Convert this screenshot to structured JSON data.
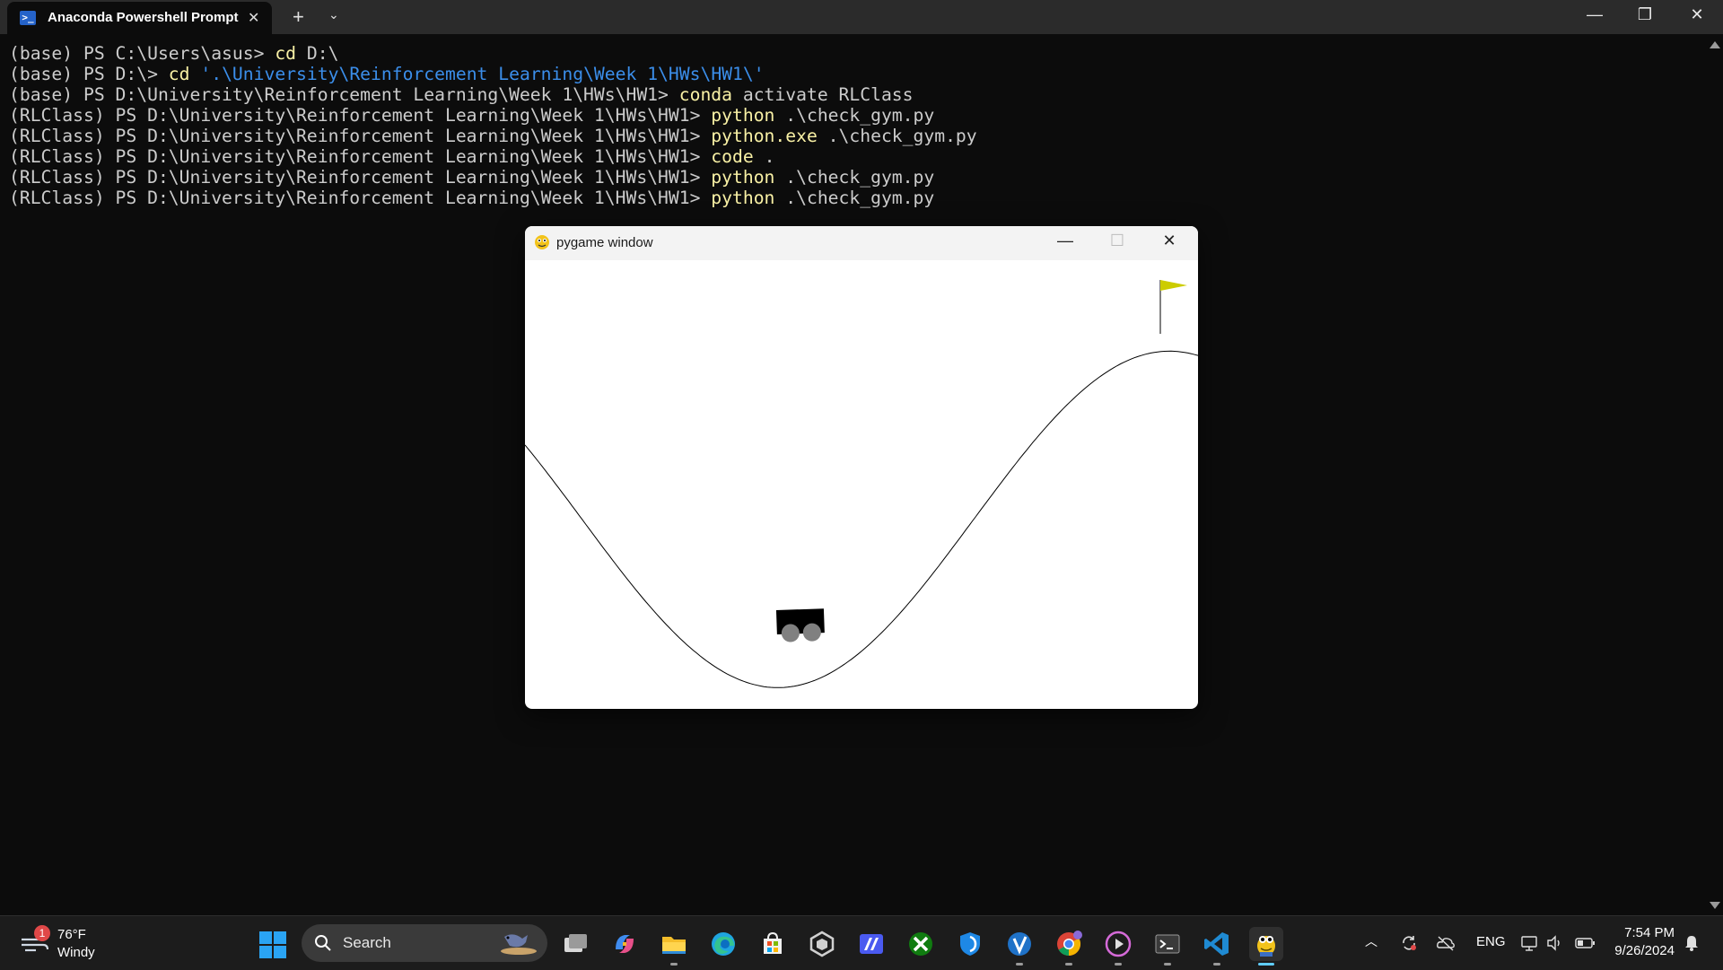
{
  "terminal": {
    "tab_title": "Anaconda Powershell Prompt",
    "lines": [
      {
        "prompt": "(base) PS C:\\Users\\asus> ",
        "cmd": "cd",
        "rest": " D:\\",
        "str": ""
      },
      {
        "prompt": "(base) PS D:\\> ",
        "cmd": "cd",
        "rest": " ",
        "str": "'.\\University\\Reinforcement Learning\\Week 1\\HWs\\HW1\\'"
      },
      {
        "prompt": "(base) PS D:\\University\\Reinforcement Learning\\Week 1\\HWs\\HW1> ",
        "cmd": "conda",
        "rest": " activate RLClass",
        "str": ""
      },
      {
        "prompt": "(RLClass) PS D:\\University\\Reinforcement Learning\\Week 1\\HWs\\HW1> ",
        "cmd": "python",
        "rest": " .\\check_gym.py",
        "str": ""
      },
      {
        "prompt": "(RLClass) PS D:\\University\\Reinforcement Learning\\Week 1\\HWs\\HW1> ",
        "cmd": "python.exe",
        "rest": " .\\check_gym.py",
        "str": ""
      },
      {
        "prompt": "(RLClass) PS D:\\University\\Reinforcement Learning\\Week 1\\HWs\\HW1> ",
        "cmd": "code",
        "rest": " .",
        "str": ""
      },
      {
        "prompt": "(RLClass) PS D:\\University\\Reinforcement Learning\\Week 1\\HWs\\HW1> ",
        "cmd": "python",
        "rest": " .\\check_gym.py",
        "str": ""
      },
      {
        "prompt": "(RLClass) PS D:\\University\\Reinforcement Learning\\Week 1\\HWs\\HW1> ",
        "cmd": "python",
        "rest": " .\\check_gym.py",
        "str": ""
      }
    ],
    "colors": {
      "text": "#cccccc",
      "command": "#f9f1a5",
      "string": "#3b8eea",
      "background": "#0c0c0c"
    }
  },
  "pygame_window": {
    "title": "pygame window",
    "scene": "mountain-car",
    "flag_color": "#cccc00",
    "car_color": "#000000",
    "wheel_color": "#808080"
  },
  "taskbar": {
    "weather": {
      "temp": "76°F",
      "condition": "Windy",
      "badge": "1"
    },
    "search_label": "Search",
    "apps": [
      "task-view-icon",
      "copilot-icon",
      "file-explorer-icon",
      "edge-icon",
      "store-icon",
      "unity-icon",
      "cursor-icon",
      "xbox-icon",
      "defender-icon",
      "v-app-icon",
      "chrome-icon",
      "media-player-icon",
      "terminal-icon",
      "vscode-icon",
      "pygame-icon"
    ],
    "tray": {
      "language": "ENG"
    },
    "clock": {
      "time": "7:54 PM",
      "date": "9/26/2024"
    }
  }
}
